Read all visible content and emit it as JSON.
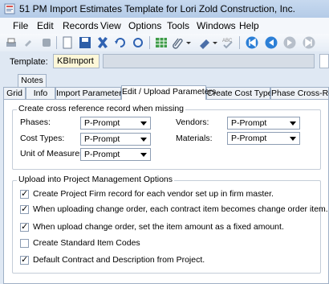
{
  "window": {
    "title": "51 PM Import Estimates Template for Lori Zold Construction, Inc."
  },
  "menu": [
    "File",
    "Edit",
    "Records",
    "View",
    "Options",
    "Tools",
    "Windows",
    "Help"
  ],
  "toolbar": {
    "icons": [
      "print-icon",
      "attach-icon",
      "stack-icon",
      "new-record-icon",
      "save-icon",
      "delete-icon",
      "undo-icon",
      "refresh-icon",
      "grid-icon",
      "paperclip-icon",
      "dropdown-icon",
      "stamp-icon",
      "spellcheck-icon",
      "first-record-icon",
      "prev-record-icon",
      "next-record-icon",
      "last-record-icon"
    ]
  },
  "template": {
    "label": "Template:",
    "value": "KBImport",
    "description": ""
  },
  "tabs": {
    "top": [
      "Notes"
    ],
    "bottom": [
      "Grid",
      "Info",
      "Import Parameters",
      "Edit / Upload Parameters",
      "Create Cost Types",
      "Phase Cross-Refs"
    ],
    "active": "Edit / Upload Parameters"
  },
  "xref": {
    "title": "Create cross reference record when missing",
    "phases": {
      "label": "Phases:",
      "value": "P-Prompt"
    },
    "cost_types": {
      "label": "Cost Types:",
      "value": "P-Prompt"
    },
    "units": {
      "label": "Unit of Measures:",
      "value": "P-Prompt"
    },
    "vendors": {
      "label": "Vendors:",
      "value": "P-Prompt"
    },
    "materials": {
      "label": "Materials:",
      "value": "P-Prompt"
    }
  },
  "upload": {
    "title": "Upload into Project Management Options",
    "options": [
      {
        "label": "Create Project Firm record for each vendor set up in firm master.",
        "checked": true
      },
      {
        "label": "When uploading change order, each contract item becomes change order item.",
        "checked": true
      },
      {
        "label": "When upload change order, set the item amount as a fixed amount.",
        "checked": true
      },
      {
        "label": "Create Standard Item Codes",
        "checked": false
      },
      {
        "label": "Default Contract and Description from Project.",
        "checked": true
      }
    ]
  }
}
